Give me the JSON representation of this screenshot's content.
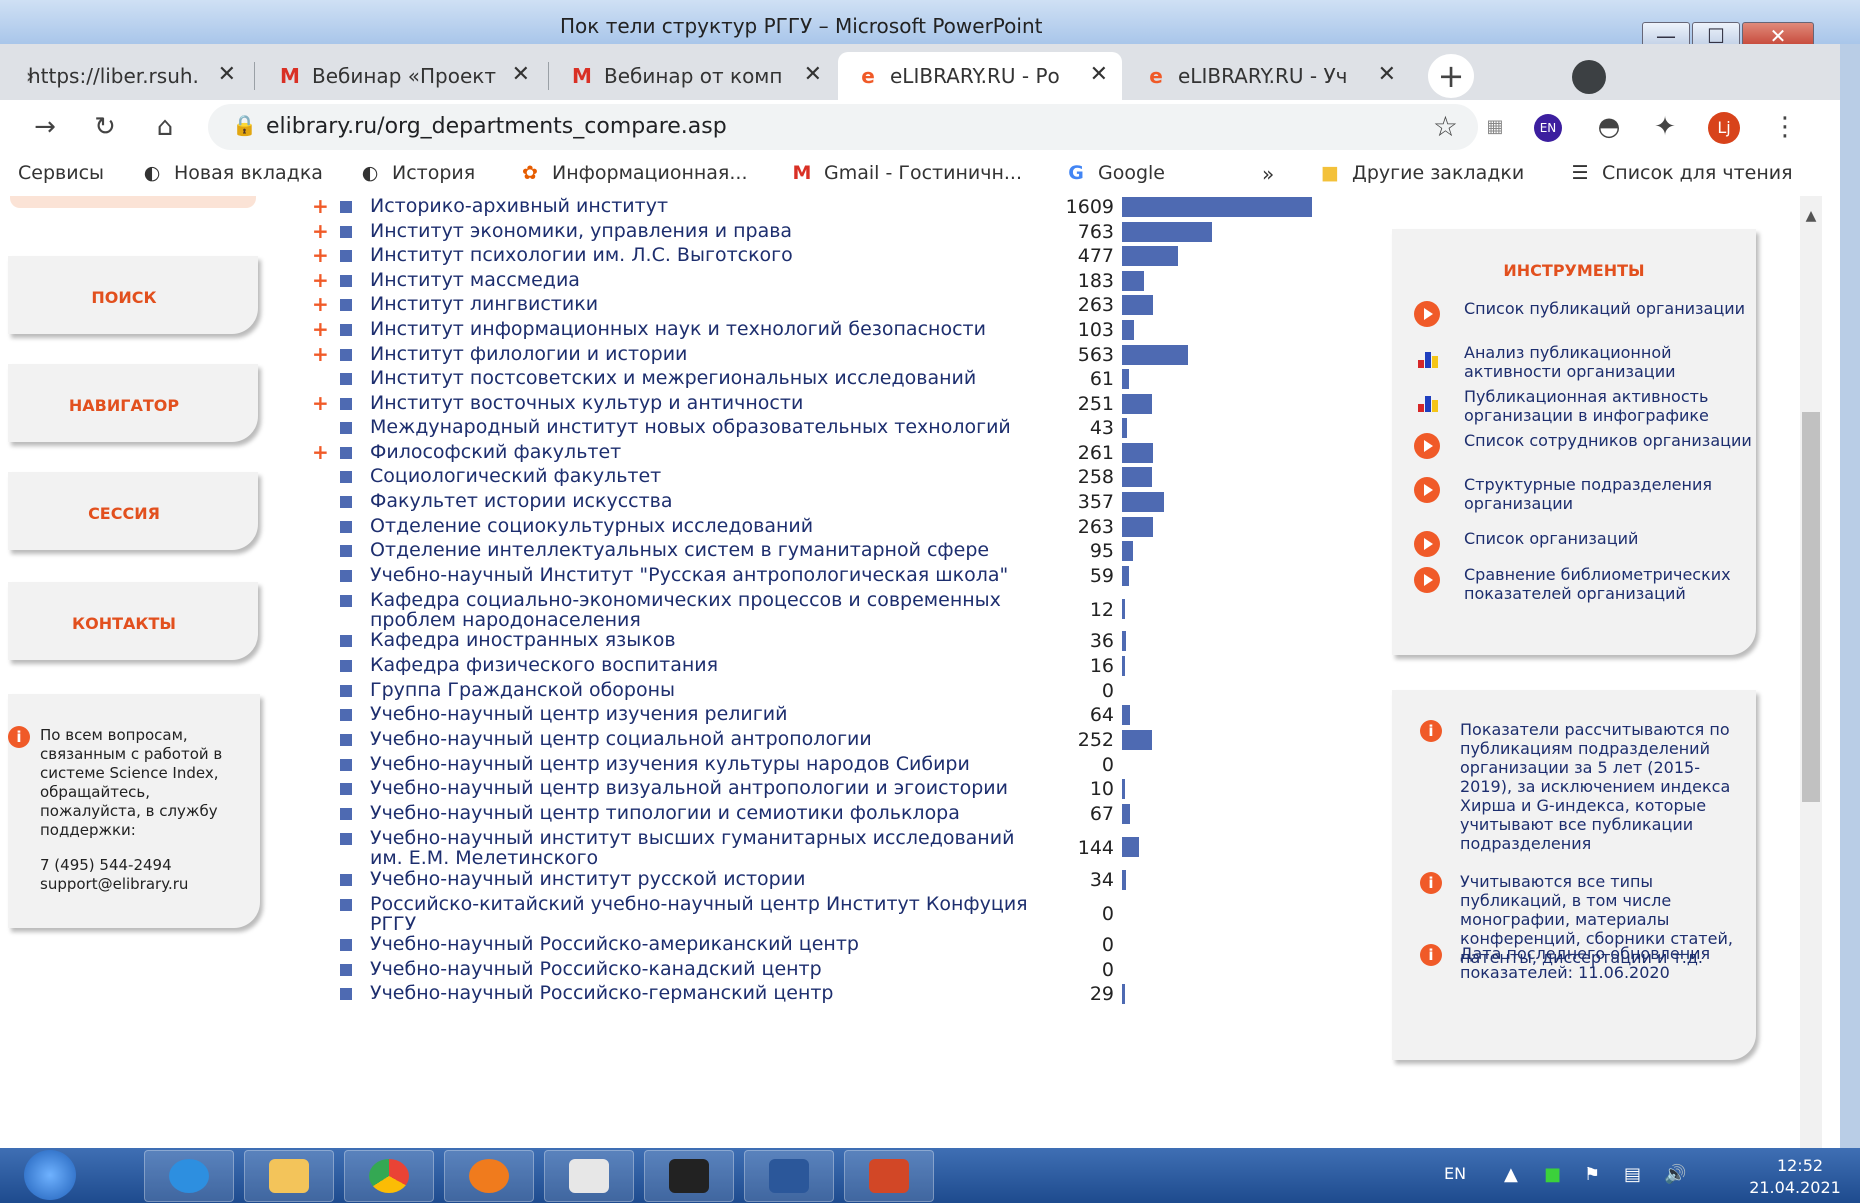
{
  "window": {
    "title": "Пок тели структур РГГУ – Microsoft PowerPoint",
    "min": "—",
    "max": "☐",
    "close": "✕"
  },
  "tabs": [
    {
      "icon": "›",
      "label": "https://liber.rsuh.r",
      "close": "✕"
    },
    {
      "icon": "M",
      "label": "Вебинар «Проект",
      "close": "✕"
    },
    {
      "icon": "M",
      "label": "Вебинар от комп",
      "close": "✕"
    },
    {
      "icon": "e",
      "label": "eLIBRARY.RU - Ро",
      "close": "✕"
    },
    {
      "icon": "e",
      "label": "eLIBRARY.RU - Уч",
      "close": "✕"
    }
  ],
  "new_tab": "+",
  "toolbar": {
    "url": "elibrary.ru/org_departments_compare.asp",
    "ext_en": "EN",
    "profile": "Lj"
  },
  "bookmarks": [
    {
      "icon": "⋮⋮",
      "label": "Сервисы"
    },
    {
      "icon": "◐",
      "label": "Новая вкладка"
    },
    {
      "icon": "◐",
      "label": "История"
    },
    {
      "icon": "✿",
      "label": "Информационная..."
    },
    {
      "icon": "M",
      "label": "Gmail - Гостиничн..."
    },
    {
      "icon": "G",
      "label": "Google"
    }
  ],
  "bookmarks_more": "»",
  "bookmarks_other": "Другие закладки",
  "bookmarks_reading": "Список для чтения",
  "nav": {
    "search": "ПОИСК",
    "navigator": "НАВИГАТОР",
    "session": "СЕССИЯ",
    "contacts": "КОНТАКТЫ"
  },
  "support": {
    "info_icon": "i",
    "text": "По всем вопросам, связанным с работой в системе Science Index, обращайтесь, пожалуйста, в службу поддержки:",
    "phone": "7 (495) 544-2494",
    "email": "support@elibrary.ru"
  },
  "departments": [
    {
      "name": "Историко-архивный институт",
      "value": "1609",
      "count": 1609,
      "expandable": true
    },
    {
      "name": "Институт экономики, управления и права",
      "value": "763",
      "count": 763,
      "expandable": true
    },
    {
      "name": "Институт психологии им. Л.С. Выготского",
      "value": "477",
      "count": 477,
      "expandable": true
    },
    {
      "name": "Институт массмедиа",
      "value": "183",
      "count": 183,
      "expandable": true
    },
    {
      "name": "Институт лингвистики",
      "value": "263",
      "count": 263,
      "expandable": true
    },
    {
      "name": "Институт информационных наук и технологий безопасности",
      "value": "103",
      "count": 103,
      "expandable": true
    },
    {
      "name": "Институт филологии и истории",
      "value": "563",
      "count": 563,
      "expandable": true
    },
    {
      "name": "Институт постсоветских и межрегиональных исследований",
      "value": "61",
      "count": 61,
      "expandable": false
    },
    {
      "name": "Институт восточных культур и античности",
      "value": "251",
      "count": 251,
      "expandable": true
    },
    {
      "name": "Международный институт новых образовательных технологий",
      "value": "43",
      "count": 43,
      "expandable": false
    },
    {
      "name": "Философский факультет",
      "value": "261",
      "count": 261,
      "expandable": true
    },
    {
      "name": "Социологический факультет",
      "value": "258",
      "count": 258,
      "expandable": false
    },
    {
      "name": "Факультет истории искусства",
      "value": "357",
      "count": 357,
      "expandable": false
    },
    {
      "name": "Отделение социокультурных исследований",
      "value": "263",
      "count": 263,
      "expandable": false
    },
    {
      "name": "Отделение интеллектуальных систем в гуманитарной сфере",
      "value": "95",
      "count": 95,
      "expandable": false
    },
    {
      "name": "Учебно-научный Институт \"Русская антропологическая школа\"",
      "value": "59",
      "count": 59,
      "expandable": false
    },
    {
      "name": "Кафедра социально-экономических процессов и современных проблем народонаселения",
      "value": "12",
      "count": 12,
      "expandable": false
    },
    {
      "name": "Кафедра иностранных языков",
      "value": "36",
      "count": 36,
      "expandable": false
    },
    {
      "name": "Кафедра физического воспитания",
      "value": "16",
      "count": 16,
      "expandable": false
    },
    {
      "name": "Группа Гражданской обороны",
      "value": "0",
      "count": 0,
      "expandable": false
    },
    {
      "name": "Учебно-научный центр изучения религий",
      "value": "64",
      "count": 64,
      "expandable": false
    },
    {
      "name": "Учебно-научный центр социальной антропологии",
      "value": "252",
      "count": 252,
      "expandable": false
    },
    {
      "name": "Учебно-научный центр изучения культуры народов Сибири",
      "value": "0",
      "count": 0,
      "expandable": false
    },
    {
      "name": "Учебно-научный центр визуальной антропологии и эгоистории",
      "value": "10",
      "count": 10,
      "expandable": false
    },
    {
      "name": "Учебно-научный центр типологии и семиотики фольклора",
      "value": "67",
      "count": 67,
      "expandable": false
    },
    {
      "name": "Учебно-научный институт высших гуманитарных исследований им. Е.М. Мелетинского",
      "value": "144",
      "count": 144,
      "expandable": false
    },
    {
      "name": "Учебно-научный институт русской истории",
      "value": "34",
      "count": 34,
      "expandable": false
    },
    {
      "name": "Российско-китайский учебно-научный центр Институт Конфуция РГГУ",
      "value": "0",
      "count": 0,
      "expandable": false
    },
    {
      "name": "Учебно-научный Российско-американский центр",
      "value": "0",
      "count": 0,
      "expandable": false
    },
    {
      "name": "Учебно-научный Российско-канадский центр",
      "value": "0",
      "count": 0,
      "expandable": false
    },
    {
      "name": "Учебно-научный Российско-германский центр",
      "value": "29",
      "count": 29,
      "expandable": false
    }
  ],
  "tools": {
    "title": "ИНСТРУМЕНТЫ",
    "items": [
      {
        "icon": "play",
        "label": "Список публикаций организации"
      },
      {
        "icon": "chart",
        "label": "Анализ публикационной активности организации"
      },
      {
        "icon": "chart",
        "label": "Публикационная активность организации в инфографике"
      },
      {
        "icon": "play",
        "label": "Список сотрудников организации"
      },
      {
        "icon": "play",
        "label": "Структурные подразделения организации"
      },
      {
        "icon": "play",
        "label": "Список организаций"
      },
      {
        "icon": "play",
        "label": "Сравнение библиометрических показателей организаций"
      }
    ]
  },
  "notes": [
    {
      "icon": "i",
      "text": "Показатели рассчитываются по публикациям подразделений организации за 5 лет (2015-2019), за исключением индекса Хирша и G-индекса, которые учитывают все публикации подразделения"
    },
    {
      "icon": "i",
      "text": "Учитываются все типы публикаций, в том числе монографии, материалы конференций, сборники статей, патенты, диссертации и т.д."
    },
    {
      "icon": "i",
      "text": "Дата последнего обновления показателей: 11.06.2020"
    }
  ],
  "taskbar": {
    "lang": "EN",
    "time": "12:52",
    "date": "21.04.2021",
    "apps": [
      "internet-explorer",
      "file-explorer",
      "chrome",
      "media-player",
      "yandex-browser",
      "photo-app",
      "word",
      "powerpoint"
    ]
  },
  "colors": {
    "accent": "#f05a28",
    "bar": "#4e6ab2",
    "link": "#1d2e6e",
    "panel": "#f2f2f2"
  }
}
